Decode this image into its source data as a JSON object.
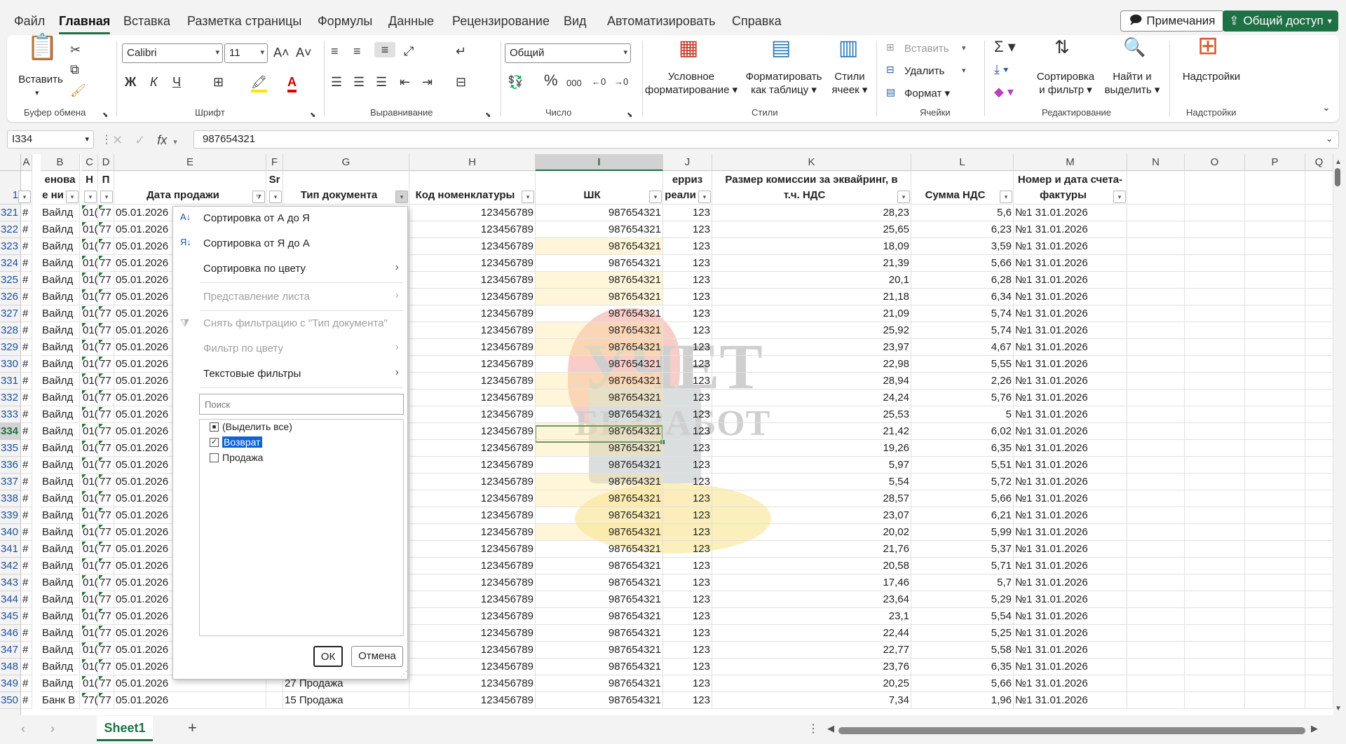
{
  "menu": {
    "items": [
      "Файл",
      "Главная",
      "Вставка",
      "Разметка страницы",
      "Формулы",
      "Данные",
      "Рецензирование",
      "Вид",
      "Автоматизировать",
      "Справка"
    ],
    "notes": "Примечания",
    "share": "Общий доступ"
  },
  "ribbon": {
    "clipboard": {
      "paste": "Вставить",
      "label": "Буфер обмена"
    },
    "font": {
      "name": "Calibri",
      "size": "11",
      "label": "Шрифт",
      "bold": "Ж",
      "italic": "К",
      "underline": "Ч"
    },
    "align": {
      "label": "Выравнивание"
    },
    "number": {
      "format": "Общий",
      "label": "Число",
      "percent": "%",
      "thousands": "000"
    },
    "styles": {
      "cond": "Условное",
      "cond2": "форматирование",
      "table": "Форматировать",
      "table2": "как таблицу",
      "cell": "Стили",
      "cell2": "ячеек",
      "label": "Стили"
    },
    "cells": {
      "insert": "Вставить",
      "delete": "Удалить",
      "format": "Формат",
      "label": "Ячейки"
    },
    "edit": {
      "sort": "Сортировка",
      "sort2": "и фильтр",
      "find": "Найти и",
      "find2": "выделить",
      "label": "Редактирование"
    },
    "addins": {
      "btn": "Надстройки",
      "label": "Надстройки"
    }
  },
  "formula": {
    "cell": "I334",
    "fx": "fx",
    "value": "987654321"
  },
  "columns": [
    "A",
    "B",
    "C",
    "D",
    "E",
    "F",
    "G",
    "H",
    "I",
    "J",
    "K",
    "L",
    "M",
    "N",
    "O",
    "P",
    "Q"
  ],
  "header": {
    "row": "1",
    "B1": "енова",
    "B2": "е ни",
    "C": "Н",
    "D": "П",
    "E": "Дата продажи",
    "F": "Sr",
    "G": "Тип документа",
    "H": "Код номенклатуры",
    "I": "ШК",
    "J1": "ерриз",
    "J2": "реали",
    "K1": "Размер комиссии за эквайринг, в",
    "K2": "т.ч. НДС",
    "L": "Сумма НДС",
    "M1": "Номер и дата счета-",
    "M2": "фактуры"
  },
  "rows": [
    {
      "n": "321",
      "a": "#",
      "b": "Вайлд",
      "c": "01(",
      "d": "77",
      "e": "05.01.2026",
      "g": "",
      "h": "123456789",
      "i": "987654321",
      "j": "123",
      "k": "28,23",
      "l": "5,6",
      "m": "№1 31.01.2026"
    },
    {
      "n": "322",
      "a": "#",
      "b": "Вайлд",
      "c": "01(",
      "d": "77",
      "e": "05.01.2026",
      "g": "",
      "h": "123456789",
      "i": "987654321",
      "j": "123",
      "k": "25,65",
      "l": "6,23",
      "m": "№1 31.01.2026"
    },
    {
      "n": "323",
      "a": "#",
      "b": "Вайлд",
      "c": "01(",
      "d": "77",
      "e": "05.01.2026",
      "g": "",
      "h": "123456789",
      "i": "987654321",
      "j": "123",
      "k": "18,09",
      "l": "3,59",
      "m": "№1 31.01.2026"
    },
    {
      "n": "324",
      "a": "#",
      "b": "Вайлд",
      "c": "01(",
      "d": "77",
      "e": "05.01.2026",
      "g": "",
      "h": "123456789",
      "i": "987654321",
      "j": "123",
      "k": "21,39",
      "l": "5,66",
      "m": "№1 31.01.2026"
    },
    {
      "n": "325",
      "a": "#",
      "b": "Вайлд",
      "c": "01(",
      "d": "77",
      "e": "05.01.2026",
      "g": "",
      "h": "123456789",
      "i": "987654321",
      "j": "123",
      "k": "20,1",
      "l": "6,28",
      "m": "№1 31.01.2026"
    },
    {
      "n": "326",
      "a": "#",
      "b": "Вайлд",
      "c": "01(",
      "d": "77",
      "e": "05.01.2026",
      "g": "",
      "h": "123456789",
      "i": "987654321",
      "j": "123",
      "k": "21,18",
      "l": "6,34",
      "m": "№1 31.01.2026"
    },
    {
      "n": "327",
      "a": "#",
      "b": "Вайлд",
      "c": "01(",
      "d": "77",
      "e": "05.01.2026",
      "g": "",
      "h": "123456789",
      "i": "987654321",
      "j": "123",
      "k": "21,09",
      "l": "5,74",
      "m": "№1 31.01.2026"
    },
    {
      "n": "328",
      "a": "#",
      "b": "Вайлд",
      "c": "01(",
      "d": "77",
      "e": "05.01.2026",
      "g": "",
      "h": "123456789",
      "i": "987654321",
      "j": "123",
      "k": "25,92",
      "l": "5,74",
      "m": "№1 31.01.2026"
    },
    {
      "n": "329",
      "a": "#",
      "b": "Вайлд",
      "c": "01(",
      "d": "77",
      "e": "05.01.2026",
      "g": "",
      "h": "123456789",
      "i": "987654321",
      "j": "123",
      "k": "23,97",
      "l": "4,67",
      "m": "№1 31.01.2026"
    },
    {
      "n": "330",
      "a": "#",
      "b": "Вайлд",
      "c": "01(",
      "d": "77",
      "e": "05.01.2026",
      "g": "",
      "h": "123456789",
      "i": "987654321",
      "j": "123",
      "k": "22,98",
      "l": "5,55",
      "m": "№1 31.01.2026"
    },
    {
      "n": "331",
      "a": "#",
      "b": "Вайлд",
      "c": "01(",
      "d": "77",
      "e": "05.01.2026",
      "g": "",
      "h": "123456789",
      "i": "987654321",
      "j": "123",
      "k": "28,94",
      "l": "2,26",
      "m": "№1 31.01.2026"
    },
    {
      "n": "332",
      "a": "#",
      "b": "Вайлд",
      "c": "01(",
      "d": "77",
      "e": "05.01.2026",
      "g": "",
      "h": "123456789",
      "i": "987654321",
      "j": "123",
      "k": "24,24",
      "l": "5,76",
      "m": "№1 31.01.2026"
    },
    {
      "n": "333",
      "a": "#",
      "b": "Вайлд",
      "c": "01(",
      "d": "77",
      "e": "05.01.2026",
      "g": "",
      "h": "123456789",
      "i": "987654321",
      "j": "123",
      "k": "25,53",
      "l": "5",
      "m": "№1 31.01.2026"
    },
    {
      "n": "334",
      "a": "#",
      "b": "Вайлд",
      "c": "01(",
      "d": "77",
      "e": "05.01.2026",
      "g": "",
      "h": "123456789",
      "i": "987654321",
      "j": "123",
      "k": "21,42",
      "l": "6,02",
      "m": "№1 31.01.2026"
    },
    {
      "n": "335",
      "a": "#",
      "b": "Вайлд",
      "c": "01(",
      "d": "77",
      "e": "05.01.2026",
      "g": "",
      "h": "123456789",
      "i": "987654321",
      "j": "123",
      "k": "19,26",
      "l": "6,35",
      "m": "№1 31.01.2026"
    },
    {
      "n": "336",
      "a": "#",
      "b": "Вайлд",
      "c": "01(",
      "d": "77",
      "e": "05.01.2026",
      "g": "",
      "h": "123456789",
      "i": "987654321",
      "j": "123",
      "k": "5,97",
      "l": "5,51",
      "m": "№1 31.01.2026"
    },
    {
      "n": "337",
      "a": "#",
      "b": "Вайлд",
      "c": "01(",
      "d": "77",
      "e": "05.01.2026",
      "g": "",
      "h": "123456789",
      "i": "987654321",
      "j": "123",
      "k": "5,54",
      "l": "5,72",
      "m": "№1 31.01.2026"
    },
    {
      "n": "338",
      "a": "#",
      "b": "Вайлд",
      "c": "01(",
      "d": "77",
      "e": "05.01.2026",
      "g": "",
      "h": "123456789",
      "i": "987654321",
      "j": "123",
      "k": "28,57",
      "l": "5,66",
      "m": "№1 31.01.2026"
    },
    {
      "n": "339",
      "a": "#",
      "b": "Вайлд",
      "c": "01(",
      "d": "77",
      "e": "05.01.2026",
      "g": "",
      "h": "123456789",
      "i": "987654321",
      "j": "123",
      "k": "23,07",
      "l": "6,21",
      "m": "№1 31.01.2026"
    },
    {
      "n": "340",
      "a": "#",
      "b": "Вайлд",
      "c": "01(",
      "d": "77",
      "e": "05.01.2026",
      "g": "",
      "h": "123456789",
      "i": "987654321",
      "j": "123",
      "k": "20,02",
      "l": "5,99",
      "m": "№1 31.01.2026"
    },
    {
      "n": "341",
      "a": "#",
      "b": "Вайлд",
      "c": "01(",
      "d": "77",
      "e": "05.01.2026",
      "g": "",
      "h": "123456789",
      "i": "987654321",
      "j": "123",
      "k": "21,76",
      "l": "5,37",
      "m": "№1 31.01.2026"
    },
    {
      "n": "342",
      "a": "#",
      "b": "Вайлд",
      "c": "01(",
      "d": "77",
      "e": "05.01.2026",
      "g": "",
      "h": "123456789",
      "i": "987654321",
      "j": "123",
      "k": "20,58",
      "l": "5,71",
      "m": "№1 31.01.2026"
    },
    {
      "n": "343",
      "a": "#",
      "b": "Вайлд",
      "c": "01(",
      "d": "77",
      "e": "05.01.2026",
      "g": "",
      "h": "123456789",
      "i": "987654321",
      "j": "123",
      "k": "17,46",
      "l": "5,7",
      "m": "№1 31.01.2026"
    },
    {
      "n": "344",
      "a": "#",
      "b": "Вайлд",
      "c": "01(",
      "d": "77",
      "e": "05.01.2026",
      "g": "",
      "h": "123456789",
      "i": "987654321",
      "j": "123",
      "k": "23,64",
      "l": "5,29",
      "m": "№1 31.01.2026"
    },
    {
      "n": "345",
      "a": "#",
      "b": "Вайлд",
      "c": "01(",
      "d": "77",
      "e": "05.01.2026",
      "g": "",
      "h": "123456789",
      "i": "987654321",
      "j": "123",
      "k": "23,1",
      "l": "5,54",
      "m": "№1 31.01.2026"
    },
    {
      "n": "346",
      "a": "#",
      "b": "Вайлд",
      "c": "01(",
      "d": "77",
      "e": "05.01.2026",
      "g": "",
      "h": "123456789",
      "i": "987654321",
      "j": "123",
      "k": "22,44",
      "l": "5,25",
      "m": "№1 31.01.2026"
    },
    {
      "n": "347",
      "a": "#",
      "b": "Вайлд",
      "c": "01(",
      "d": "77",
      "e": "05.01.2026",
      "g": "",
      "h": "123456789",
      "i": "987654321",
      "j": "123",
      "k": "22,77",
      "l": "5,58",
      "m": "№1 31.01.2026"
    },
    {
      "n": "348",
      "a": "#",
      "b": "Вайлд",
      "c": "01(",
      "d": "77",
      "e": "05.01.2026",
      "g": "",
      "h": "123456789",
      "i": "987654321",
      "j": "123",
      "k": "23,76",
      "l": "6,35",
      "m": "№1 31.01.2026"
    },
    {
      "n": "349",
      "a": "#",
      "b": "Вайлд",
      "c": "01(",
      "d": "77",
      "e": "05.01.2026",
      "g": "27 Продажа",
      "h": "123456789",
      "i": "987654321",
      "j": "123",
      "k": "20,25",
      "l": "5,66",
      "m": "№1 31.01.2026"
    },
    {
      "n": "350",
      "a": "#",
      "b": "Банк В",
      "c": "77(",
      "d": "77",
      "e": "05.01.2026",
      "g": "15 Продажа",
      "h": "123456789",
      "i": "987654321",
      "j": "123",
      "k": "7,34",
      "l": "1,96",
      "m": "№1 31.01.2026"
    }
  ],
  "selected_row": "334",
  "popup": {
    "sort_az": "Сортировка от А до Я",
    "sort_za": "Сортировка от Я до А",
    "sort_color": "Сортировка по цвету",
    "sheet_view": "Представление листа",
    "clear_filter": "Снять фильтрацию с \"Тип документа\"",
    "filter_color": "Фильтр по цвету",
    "text_filters": "Текстовые фильтры",
    "search_placeholder": "Поиск",
    "items": [
      "(Выделить все)",
      "Возврат",
      "Продажа"
    ],
    "ok": "ОК",
    "cancel": "Отмена"
  },
  "watermark": {
    "line1": "УЧЕТ",
    "line2": "БЕЗЗАБОТ"
  },
  "tabs": {
    "sheet": "Sheet1",
    "add": "+"
  }
}
